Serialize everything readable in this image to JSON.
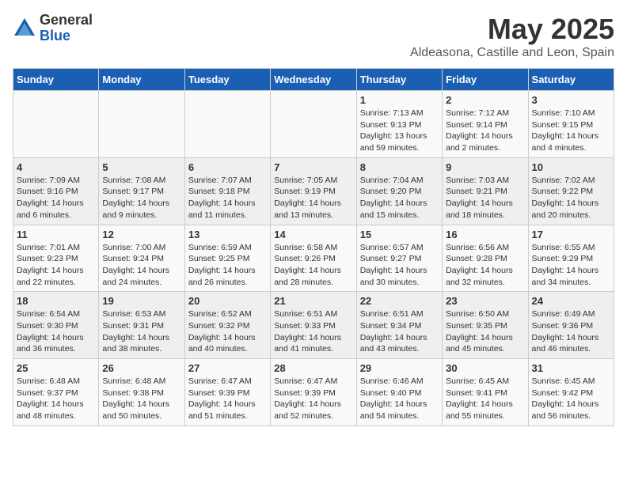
{
  "header": {
    "logo_general": "General",
    "logo_blue": "Blue",
    "main_title": "May 2025",
    "subtitle": "Aldeasona, Castille and Leon, Spain"
  },
  "calendar": {
    "days_of_week": [
      "Sunday",
      "Monday",
      "Tuesday",
      "Wednesday",
      "Thursday",
      "Friday",
      "Saturday"
    ],
    "weeks": [
      [
        {
          "day": "",
          "info": ""
        },
        {
          "day": "",
          "info": ""
        },
        {
          "day": "",
          "info": ""
        },
        {
          "day": "",
          "info": ""
        },
        {
          "day": "1",
          "info": "Sunrise: 7:13 AM\nSunset: 9:13 PM\nDaylight: 13 hours\nand 59 minutes."
        },
        {
          "day": "2",
          "info": "Sunrise: 7:12 AM\nSunset: 9:14 PM\nDaylight: 14 hours\nand 2 minutes."
        },
        {
          "day": "3",
          "info": "Sunrise: 7:10 AM\nSunset: 9:15 PM\nDaylight: 14 hours\nand 4 minutes."
        }
      ],
      [
        {
          "day": "4",
          "info": "Sunrise: 7:09 AM\nSunset: 9:16 PM\nDaylight: 14 hours\nand 6 minutes."
        },
        {
          "day": "5",
          "info": "Sunrise: 7:08 AM\nSunset: 9:17 PM\nDaylight: 14 hours\nand 9 minutes."
        },
        {
          "day": "6",
          "info": "Sunrise: 7:07 AM\nSunset: 9:18 PM\nDaylight: 14 hours\nand 11 minutes."
        },
        {
          "day": "7",
          "info": "Sunrise: 7:05 AM\nSunset: 9:19 PM\nDaylight: 14 hours\nand 13 minutes."
        },
        {
          "day": "8",
          "info": "Sunrise: 7:04 AM\nSunset: 9:20 PM\nDaylight: 14 hours\nand 15 minutes."
        },
        {
          "day": "9",
          "info": "Sunrise: 7:03 AM\nSunset: 9:21 PM\nDaylight: 14 hours\nand 18 minutes."
        },
        {
          "day": "10",
          "info": "Sunrise: 7:02 AM\nSunset: 9:22 PM\nDaylight: 14 hours\nand 20 minutes."
        }
      ],
      [
        {
          "day": "11",
          "info": "Sunrise: 7:01 AM\nSunset: 9:23 PM\nDaylight: 14 hours\nand 22 minutes."
        },
        {
          "day": "12",
          "info": "Sunrise: 7:00 AM\nSunset: 9:24 PM\nDaylight: 14 hours\nand 24 minutes."
        },
        {
          "day": "13",
          "info": "Sunrise: 6:59 AM\nSunset: 9:25 PM\nDaylight: 14 hours\nand 26 minutes."
        },
        {
          "day": "14",
          "info": "Sunrise: 6:58 AM\nSunset: 9:26 PM\nDaylight: 14 hours\nand 28 minutes."
        },
        {
          "day": "15",
          "info": "Sunrise: 6:57 AM\nSunset: 9:27 PM\nDaylight: 14 hours\nand 30 minutes."
        },
        {
          "day": "16",
          "info": "Sunrise: 6:56 AM\nSunset: 9:28 PM\nDaylight: 14 hours\nand 32 minutes."
        },
        {
          "day": "17",
          "info": "Sunrise: 6:55 AM\nSunset: 9:29 PM\nDaylight: 14 hours\nand 34 minutes."
        }
      ],
      [
        {
          "day": "18",
          "info": "Sunrise: 6:54 AM\nSunset: 9:30 PM\nDaylight: 14 hours\nand 36 minutes."
        },
        {
          "day": "19",
          "info": "Sunrise: 6:53 AM\nSunset: 9:31 PM\nDaylight: 14 hours\nand 38 minutes."
        },
        {
          "day": "20",
          "info": "Sunrise: 6:52 AM\nSunset: 9:32 PM\nDaylight: 14 hours\nand 40 minutes."
        },
        {
          "day": "21",
          "info": "Sunrise: 6:51 AM\nSunset: 9:33 PM\nDaylight: 14 hours\nand 41 minutes."
        },
        {
          "day": "22",
          "info": "Sunrise: 6:51 AM\nSunset: 9:34 PM\nDaylight: 14 hours\nand 43 minutes."
        },
        {
          "day": "23",
          "info": "Sunrise: 6:50 AM\nSunset: 9:35 PM\nDaylight: 14 hours\nand 45 minutes."
        },
        {
          "day": "24",
          "info": "Sunrise: 6:49 AM\nSunset: 9:36 PM\nDaylight: 14 hours\nand 46 minutes."
        }
      ],
      [
        {
          "day": "25",
          "info": "Sunrise: 6:48 AM\nSunset: 9:37 PM\nDaylight: 14 hours\nand 48 minutes."
        },
        {
          "day": "26",
          "info": "Sunrise: 6:48 AM\nSunset: 9:38 PM\nDaylight: 14 hours\nand 50 minutes."
        },
        {
          "day": "27",
          "info": "Sunrise: 6:47 AM\nSunset: 9:39 PM\nDaylight: 14 hours\nand 51 minutes."
        },
        {
          "day": "28",
          "info": "Sunrise: 6:47 AM\nSunset: 9:39 PM\nDaylight: 14 hours\nand 52 minutes."
        },
        {
          "day": "29",
          "info": "Sunrise: 6:46 AM\nSunset: 9:40 PM\nDaylight: 14 hours\nand 54 minutes."
        },
        {
          "day": "30",
          "info": "Sunrise: 6:45 AM\nSunset: 9:41 PM\nDaylight: 14 hours\nand 55 minutes."
        },
        {
          "day": "31",
          "info": "Sunrise: 6:45 AM\nSunset: 9:42 PM\nDaylight: 14 hours\nand 56 minutes."
        }
      ]
    ]
  }
}
